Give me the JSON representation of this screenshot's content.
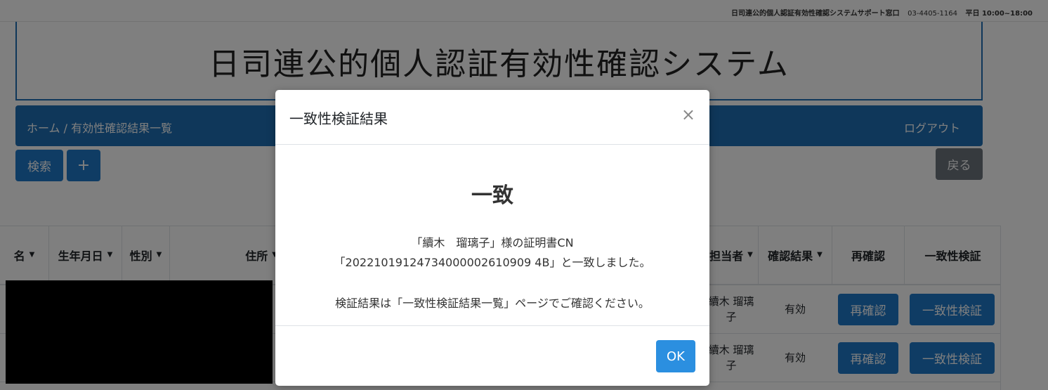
{
  "topbar": {
    "support_label": "日司連公的個人認証有効性確認システムサポート窓口",
    "phone": "03-4405-1164",
    "hours": "平日 10:00~18:00"
  },
  "header": {
    "title": "日司連公的個人認証有効性確認システム"
  },
  "navbar": {
    "breadcrumb": "ホーム / 有効性確認結果一覧",
    "logout": "ログアウト"
  },
  "toolbar": {
    "search": "検索",
    "add": "+",
    "back": "戻る"
  },
  "table": {
    "columns": {
      "name": "名",
      "birthdate": "生年月日",
      "gender": "性別",
      "address": "住所",
      "staff": "担当者",
      "result": "確認結果",
      "recheck": "再確認",
      "verify": "一致性検証"
    },
    "rows": [
      {
        "staff": "續木 瑠璃子",
        "result": "有効",
        "recheck": "再確認",
        "verify": "一致性検証"
      },
      {
        "staff": "續木 瑠璃子",
        "result": "有効",
        "recheck": "再確認",
        "verify": "一致性検証"
      }
    ]
  },
  "modal": {
    "title": "一致性検証結果",
    "close": "×",
    "heading": "一致",
    "message_line1": "「續木　瑠璃子」様の証明書CN",
    "message_line2": "「20221019124734000002610909 4B」と一致しました。",
    "message_line3": "検証結果は「一致性検証結果一覧」ページでご確認ください。",
    "ok": "OK"
  },
  "colors": {
    "primary": "#1f6fb5",
    "button": "#1f78c8",
    "ok": "#2b8fe0",
    "back": "#6c757d"
  }
}
